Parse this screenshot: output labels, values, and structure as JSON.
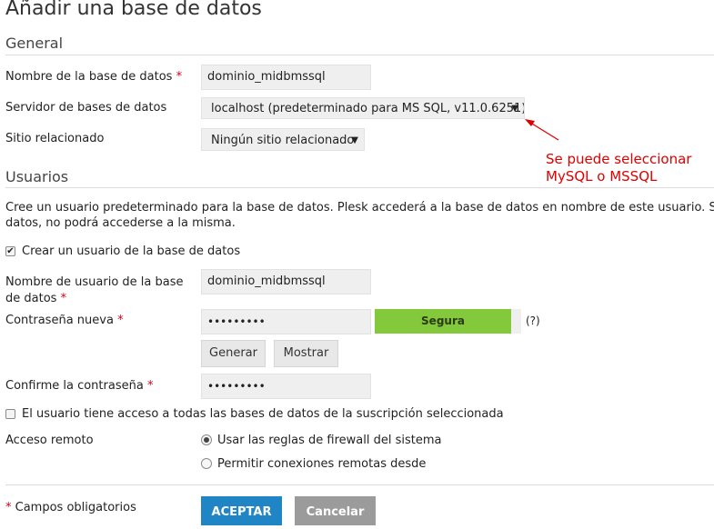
{
  "page": {
    "title": "Añadir una base de datos"
  },
  "general": {
    "section_title": "General",
    "db_name_label": "Nombre de la base de datos",
    "db_name_value": "dominio_midbmssql",
    "db_server_label": "Servidor de bases de datos",
    "db_server_value": "localhost (predeterminado para MS SQL, v11.0.6251)",
    "related_site_label": "Sitio relacionado",
    "related_site_value": "Ningún sitio relacionado",
    "required_mark": "*"
  },
  "annotation": {
    "line1": "Se puede seleccionar",
    "line2": "MySQL o MSSQL",
    "color": "#e00000"
  },
  "users": {
    "section_title": "Usuarios",
    "description_line1": "Cree un usuario predeterminado para la base de datos. Plesk accederá a la base de datos en nombre de este usuario. Si no se as",
    "description_line2": "datos, no podrá accederse a la misma.",
    "create_user_label": "Crear un usuario de la base de datos",
    "create_user_checked": true,
    "username_label_line1": "Nombre de usuario de la base",
    "username_label_line2": "de datos",
    "username_value": "dominio_midbmssql",
    "new_password_label": "Contraseña nueva",
    "password_value": "•••••••••",
    "strength_label": "Segura",
    "strength_color": "#84c93c",
    "strength_fraction": 1.0,
    "help_label": "(?)",
    "generate_label": "Generar",
    "show_label": "Mostrar",
    "confirm_password_label": "Confirme la contraseña",
    "confirm_password_value": "•••••••••",
    "all_dbs_access_label": "El usuario tiene acceso a todas las bases de datos de la suscripción seleccionada",
    "all_dbs_access_checked": false,
    "remote_access_label": "Acceso remoto",
    "remote_option_firewall": "Usar las reglas de firewall del sistema",
    "remote_option_allow": "Permitir conexiones remotas desde",
    "selected_remote_option": "firewall"
  },
  "footer": {
    "required_note": "Campos obligatorios",
    "ok_label": "ACEPTAR",
    "cancel_label": "Cancelar",
    "ok_color": "#1f85c4",
    "cancel_color": "#9b9b9b"
  }
}
